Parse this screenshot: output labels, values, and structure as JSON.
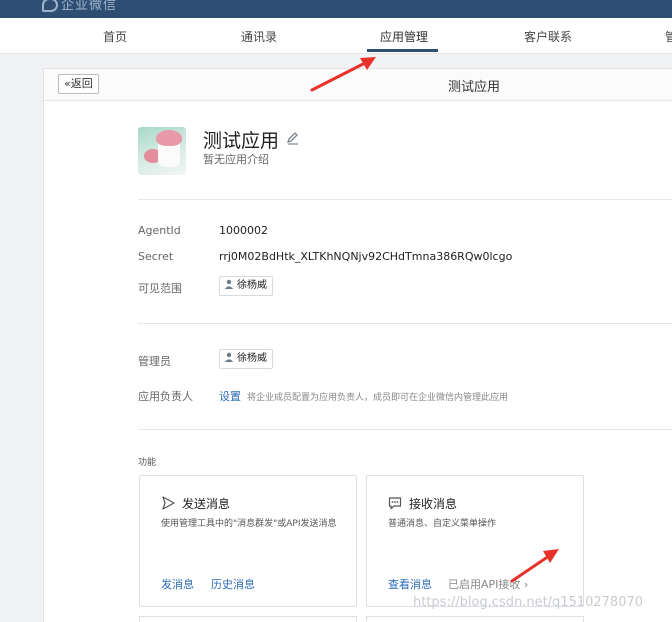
{
  "topbar": {
    "logo_text": "企业微信"
  },
  "nav": {
    "items": [
      {
        "label": "首页"
      },
      {
        "label": "通讯录"
      },
      {
        "label": "应用管理"
      },
      {
        "label": "客户联系"
      },
      {
        "label": "管"
      }
    ],
    "active": "应用管理"
  },
  "panel": {
    "back_label": "返回",
    "title": "测试应用"
  },
  "app": {
    "name": "测试应用",
    "description": "暂无应用介绍",
    "icon": "app-photo-icon"
  },
  "details": {
    "agentid_label": "AgentId",
    "agentid_value": "1000002",
    "secret_label": "Secret",
    "secret_value": "rrj0M02BdHtk_XLTKhNQNjv92CHdTmna386RQw0lcgo",
    "scope_label": "可见范围",
    "scope_user": "徐杨威"
  },
  "admins": {
    "admin_label": "管理员",
    "admin_user": "徐杨威",
    "owner_label": "应用负责人",
    "owner_link": "设置",
    "owner_hint": "将企业成员配置为应用负责人，成员即可在企业微信内管理此应用"
  },
  "features": {
    "section_title": "功能",
    "cards": [
      {
        "title": "发送消息",
        "icon": "send-icon",
        "description": "使用管理工具中的\"消息群发\"或API发送消息",
        "link1": "发消息",
        "link2": "历史消息"
      },
      {
        "title": "接收消息",
        "icon": "chat-bubble-icon",
        "description": "普通消息、自定义菜单操作",
        "link1": "查看消息",
        "link2": "已启用API接收"
      }
    ]
  },
  "watermark": "https://blog.csdn.net/q1510278070",
  "colors": {
    "topbar": "#2e4e73",
    "link": "#2a6bb8",
    "annotation_arrow": "#e8322b"
  }
}
